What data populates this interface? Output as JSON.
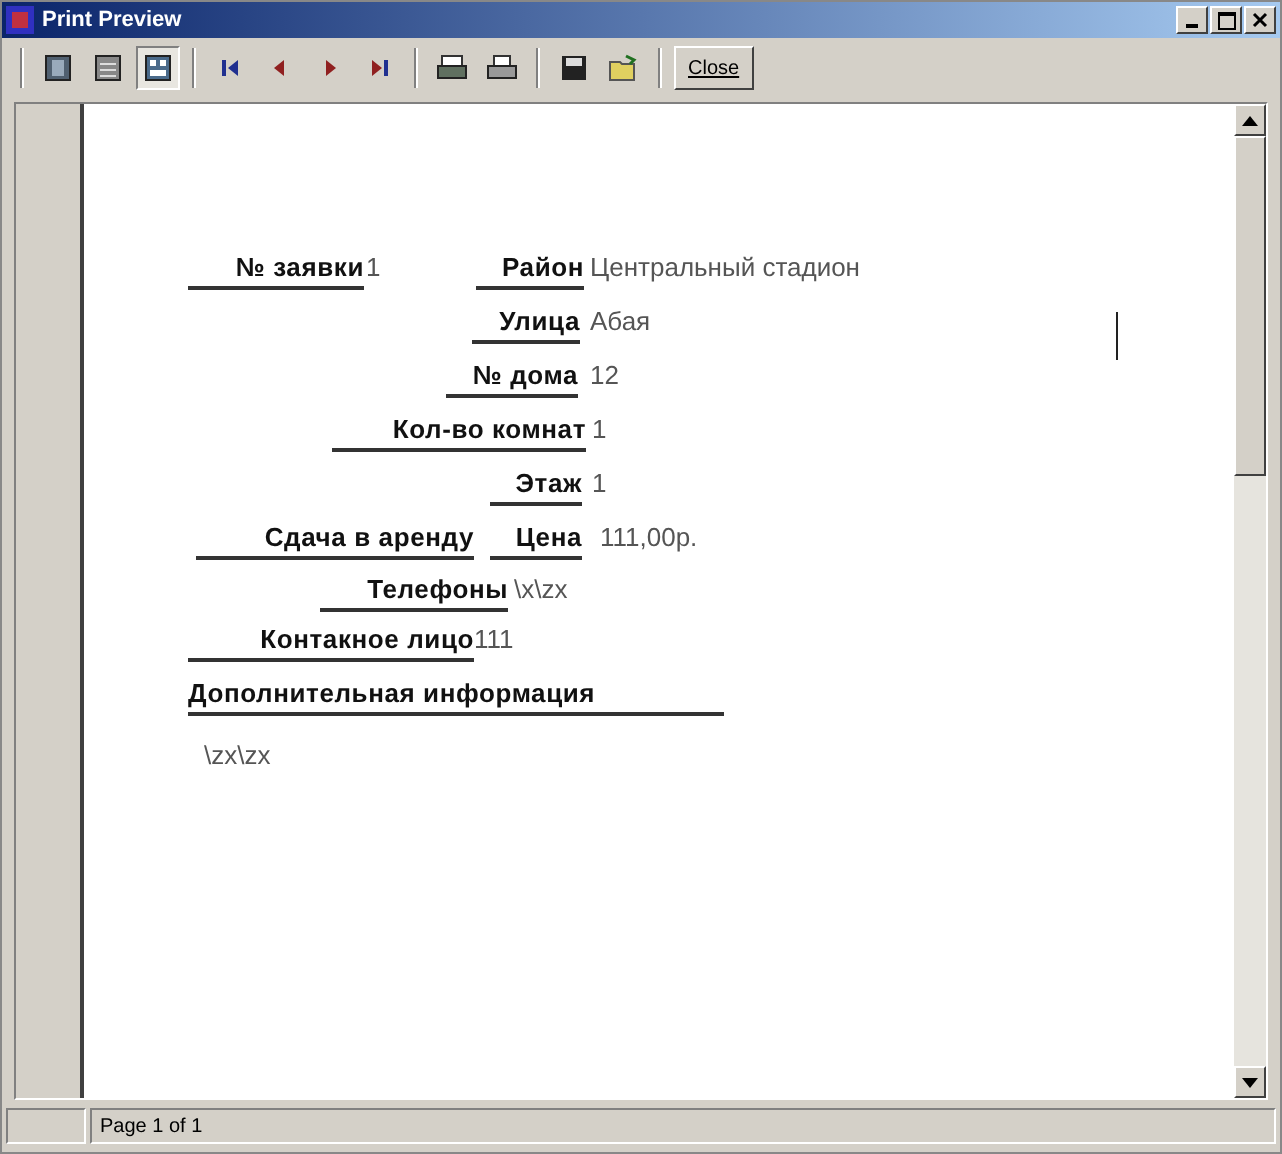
{
  "window": {
    "title": "Print Preview"
  },
  "toolbar": {
    "view_buttons": [
      {
        "kind": "single",
        "selected": false
      },
      {
        "kind": "list",
        "selected": false
      },
      {
        "kind": "fit",
        "selected": true
      }
    ],
    "close_button": "Close"
  },
  "report": {
    "fields": [
      {
        "label": "№ заявки",
        "value": "1"
      },
      {
        "label": "Район",
        "value": "Центральный стадион"
      },
      {
        "label": "Улица",
        "value": "Абая"
      },
      {
        "label": "№ дома",
        "value": "12"
      },
      {
        "label": "Кол-во комнат",
        "value": "1"
      },
      {
        "label": "Этаж",
        "value": "1"
      },
      {
        "label": "Сдача в аренду"
      },
      {
        "label": "Цена",
        "value": "111,00р."
      },
      {
        "label": "Телефоны",
        "value": "\\x\\zx"
      },
      {
        "label": "Контакное лицо",
        "value": "111"
      },
      {
        "label": "Дополнительная информация",
        "value": "\\zx\\zx"
      }
    ]
  },
  "status_bar": {
    "text": "Page 1 of 1"
  }
}
